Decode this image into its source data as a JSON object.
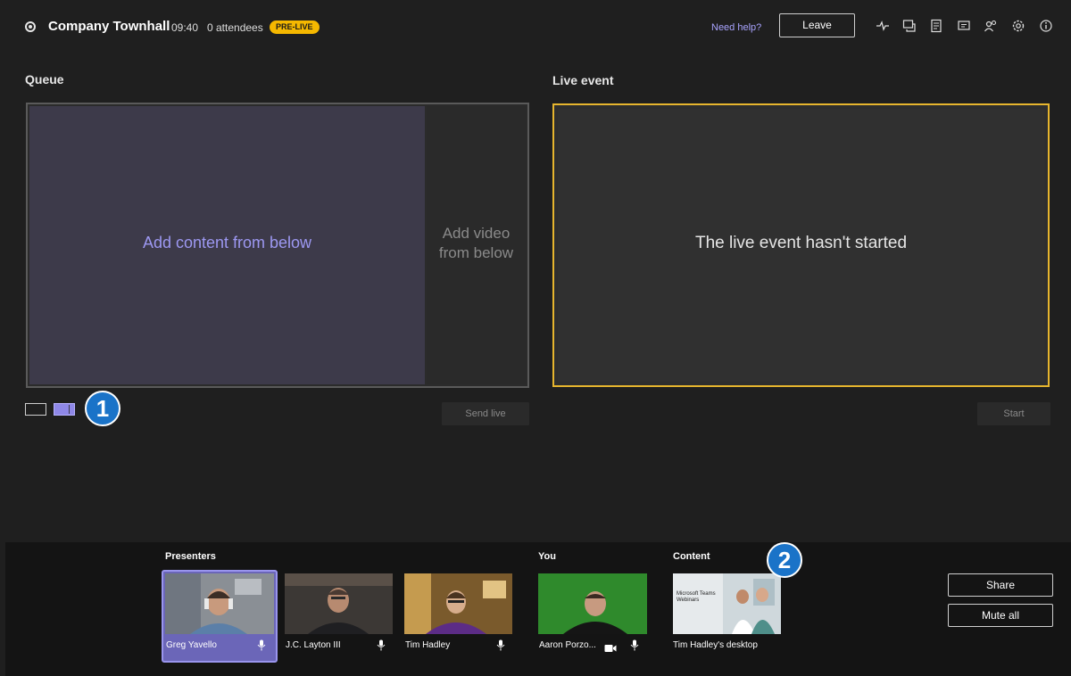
{
  "header": {
    "title": "Company Townhall",
    "time": "09:40",
    "attendees": "0 attendees",
    "badge": "PRE-LIVE",
    "help": "Need help?",
    "leave_label": "Leave",
    "tool_icons": [
      "pulse-icon",
      "chat-icon",
      "notes-icon",
      "qa-icon",
      "people-icon",
      "settings-icon",
      "info-icon"
    ]
  },
  "queue": {
    "label": "Queue",
    "content_placeholder": "Add content from below",
    "video_placeholder_line1": "Add video",
    "video_placeholder_line2": "from below",
    "send_live_label": "Send live"
  },
  "live": {
    "label": "Live event",
    "status_text": "The live event hasn't started",
    "start_label": "Start"
  },
  "callouts": {
    "one": "1",
    "two": "2"
  },
  "tray": {
    "presenters_label": "Presenters",
    "you_label": "You",
    "content_label": "Content",
    "presenters": [
      {
        "name": "Greg Yavello"
      },
      {
        "name": "J.C. Layton III"
      },
      {
        "name": "Tim Hadley"
      }
    ],
    "you": {
      "name": "Aaron Porzo..."
    },
    "content": {
      "name": "Tim Hadley's desktop",
      "slide_line1": "Microsoft Teams",
      "slide_line2": "Webinars"
    },
    "share_label": "Share",
    "mute_all_label": "Mute all"
  },
  "colors": {
    "accent": "#8f88e8",
    "live_border": "#e6b52e",
    "badge": "#f5b800",
    "callout": "#1a73c8"
  }
}
